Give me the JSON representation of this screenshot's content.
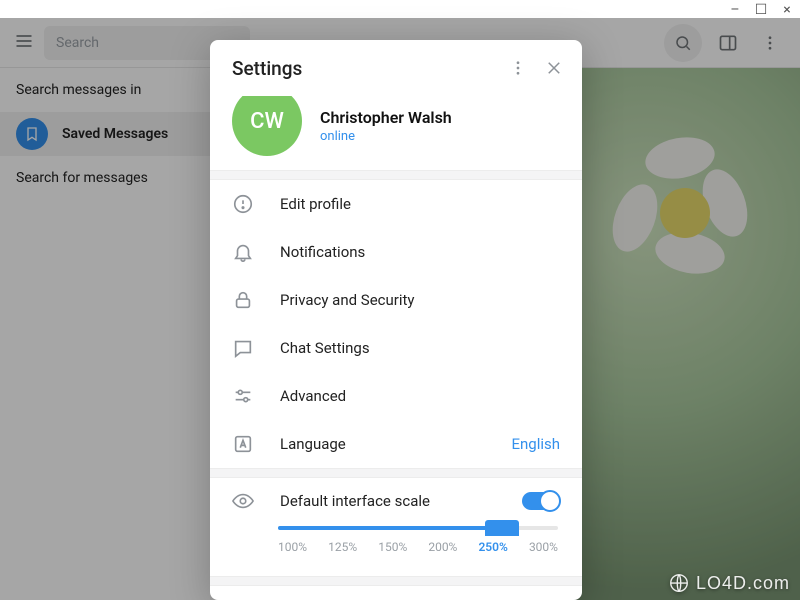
{
  "window": {
    "min": "–",
    "max": "☐",
    "close": "×"
  },
  "topbar": {
    "search_placeholder": "Search"
  },
  "sidebar": {
    "items": [
      {
        "label": "Search messages in"
      },
      {
        "label": "Saved Messages"
      },
      {
        "label": "Search for messages"
      }
    ]
  },
  "settings": {
    "title": "Settings",
    "profile": {
      "initials": "CW",
      "name": "Christopher Walsh",
      "status": "online"
    },
    "menu": [
      {
        "key": "edit-profile",
        "label": "Edit profile"
      },
      {
        "key": "notifications",
        "label": "Notifications"
      },
      {
        "key": "privacy",
        "label": "Privacy and Security"
      },
      {
        "key": "chat-settings",
        "label": "Chat Settings"
      },
      {
        "key": "advanced",
        "label": "Advanced"
      },
      {
        "key": "language",
        "label": "Language",
        "value": "English"
      }
    ],
    "scale": {
      "label": "Default interface scale",
      "enabled": true,
      "options": [
        "100%",
        "125%",
        "150%",
        "200%",
        "250%",
        "300%"
      ],
      "selected_index": 4
    }
  },
  "watermark": "LO4D.com"
}
